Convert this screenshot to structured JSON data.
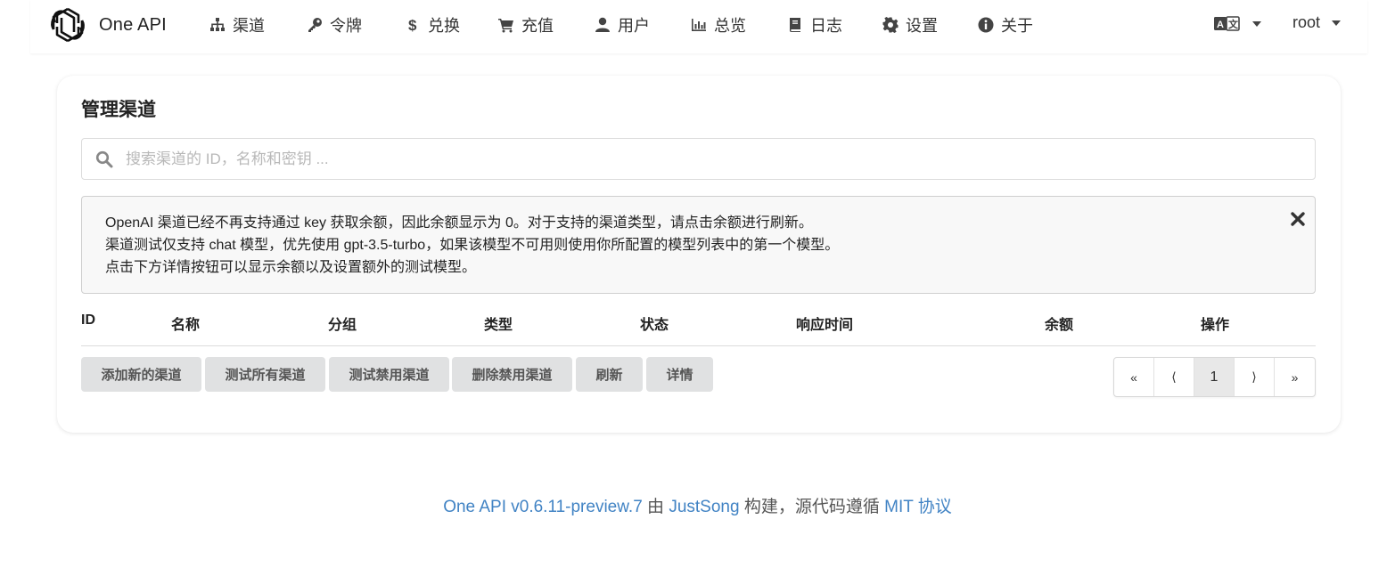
{
  "brand": {
    "name": "One API"
  },
  "menu": [
    {
      "label": "渠道",
      "icon": "sitemap-icon"
    },
    {
      "label": "令牌",
      "icon": "key-icon"
    },
    {
      "label": "兑换",
      "icon": "dollar-icon"
    },
    {
      "label": "充值",
      "icon": "cart-icon"
    },
    {
      "label": "用户",
      "icon": "user-icon"
    },
    {
      "label": "总览",
      "icon": "bar-chart-icon"
    },
    {
      "label": "日志",
      "icon": "book-icon"
    },
    {
      "label": "设置",
      "icon": "gear-icon"
    },
    {
      "label": "关于",
      "icon": "info-icon"
    }
  ],
  "user": {
    "name": "root"
  },
  "page": {
    "title": "管理渠道",
    "search_placeholder": "搜索渠道的 ID，名称和密钥 ..."
  },
  "notice": {
    "lines": [
      "OpenAI 渠道已经不再支持通过 key 获取余额，因此余额显示为 0。对于支持的渠道类型，请点击余额进行刷新。",
      "渠道测试仅支持 chat 模型，优先使用 gpt-3.5-turbo，如果该模型不可用则使用你所配置的模型列表中的第一个模型。",
      "点击下方详情按钮可以显示余额以及设置额外的测试模型。"
    ]
  },
  "table": {
    "columns": [
      "ID",
      "名称",
      "分组",
      "类型",
      "状态",
      "响应时间",
      "余额",
      "操作"
    ],
    "rows": []
  },
  "actions": {
    "add": "添加新的渠道",
    "test_all": "测试所有渠道",
    "test_disabled": "测试禁用渠道",
    "delete_disabled": "删除禁用渠道",
    "refresh": "刷新",
    "details": "详情"
  },
  "pagination": {
    "first": "«",
    "prev": "⟨",
    "current": "1",
    "next": "⟩",
    "last": "»"
  },
  "footer": {
    "version_link": "One API v0.6.11-preview.7",
    "by": " 由 ",
    "author_link": "JustSong",
    "built": " 构建，源代码遵循 ",
    "license_link": "MIT 协议"
  },
  "colors": {
    "link": "#4183c4",
    "button_bg": "#e0e1e2",
    "notice_bg": "#f8f8f8"
  }
}
